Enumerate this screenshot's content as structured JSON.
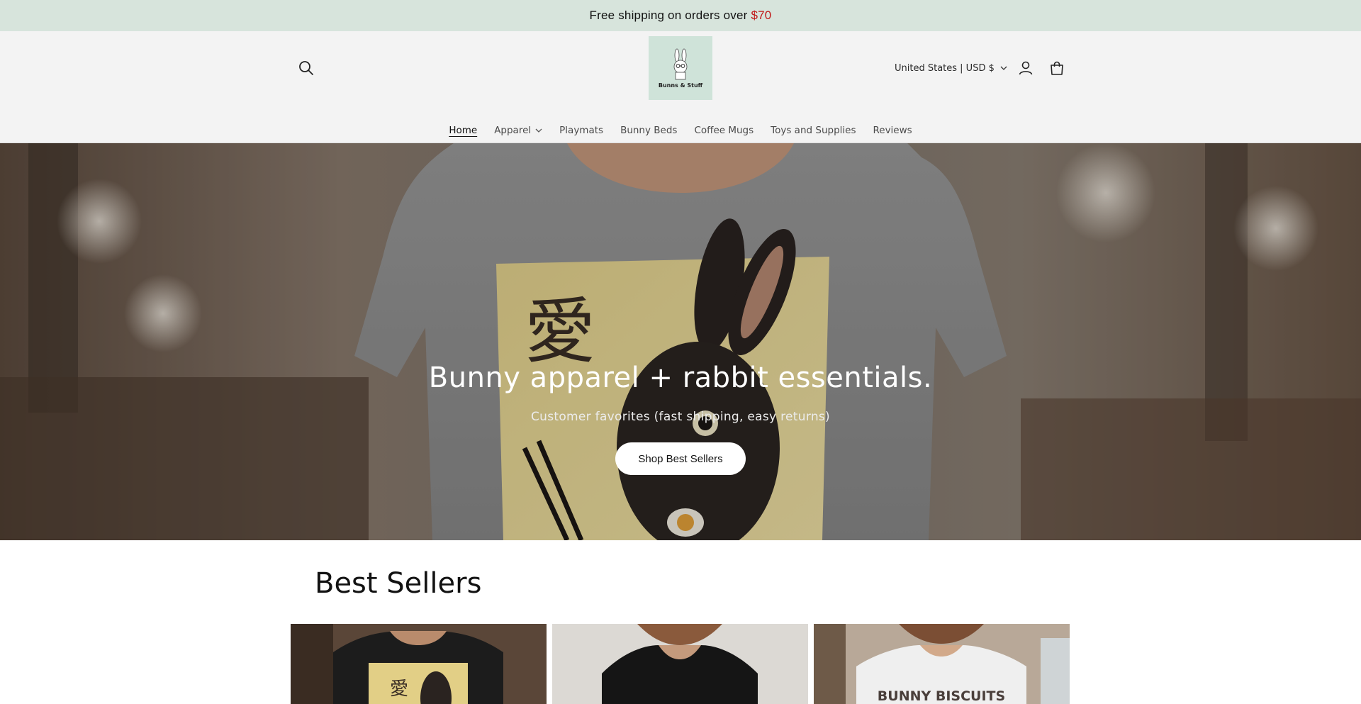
{
  "announcement": {
    "text": "Free shipping on orders over",
    "price": "$70"
  },
  "header": {
    "logo_text": "Bunns & Stuff",
    "localization": "United States | USD $",
    "icons": {
      "search": "search-icon",
      "account": "account-icon",
      "cart": "cart-icon"
    }
  },
  "nav": {
    "items": [
      {
        "label": "Home",
        "active": true
      },
      {
        "label": "Apparel",
        "dropdown": true
      },
      {
        "label": "Playmats"
      },
      {
        "label": "Bunny Beds"
      },
      {
        "label": "Coffee Mugs"
      },
      {
        "label": "Toys and Supplies"
      },
      {
        "label": "Reviews"
      }
    ]
  },
  "hero": {
    "title": "Bunny apparel + rabbit essentials.",
    "subtitle": "Customer favorites (fast shipping, easy returns)",
    "button_label": "Shop Best Sellers",
    "shirt_glyph": "愛"
  },
  "best_sellers": {
    "title": "Best Sellers",
    "products": [
      {
        "glyph": "愛"
      },
      {},
      {
        "print_text": "BUNNY BISCUITS"
      }
    ]
  },
  "colors": {
    "announcement_bg": "#d7e4dc",
    "price_accent": "#c01616",
    "header_bg": "#f3f3f3",
    "logo_bg": "#cfe3d9"
  }
}
